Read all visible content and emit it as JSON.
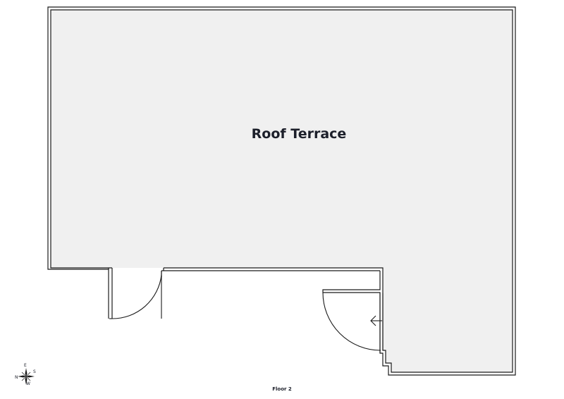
{
  "plan": {
    "room": {
      "name": "Roof Terrace",
      "fill_color": "#f0f0f0"
    },
    "floor_label": "Floor 2",
    "compass": {
      "north": "N",
      "east": "E",
      "south": "S",
      "west": "W"
    },
    "wall_color": "#1a1a1a"
  }
}
